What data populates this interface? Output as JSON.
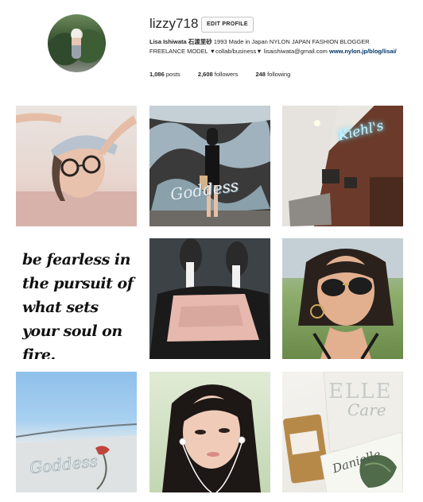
{
  "profile": {
    "username": "lizzy718",
    "edit_label": "EDIT PROFILE",
    "bio_name": "Lisa Ishiwata 石渡里砂",
    "bio_text": " 1993 Made in Japan NYLON JAPAN FASHION BLOGGER FREELANCE MODEL ▼collab/business▼ lisaishiwata@gmail.com ",
    "bio_link": "www.nylon.jp/blog/lisai/"
  },
  "stats": {
    "posts_count": "1,086",
    "posts_label": "posts",
    "followers_count": "2,608",
    "followers_label": "followers",
    "following_count": "248",
    "following_label": "following"
  },
  "posts": [
    {
      "id": "post-1"
    },
    {
      "id": "post-2",
      "overlay_text": "Goddess"
    },
    {
      "id": "post-3",
      "overlay_text": "Kiehl's"
    },
    {
      "id": "post-4",
      "overlay_text": "be fearless in the pursuit of what sets your soul on fire."
    },
    {
      "id": "post-5"
    },
    {
      "id": "post-6"
    },
    {
      "id": "post-7",
      "overlay_text": "Goddess"
    },
    {
      "id": "post-8"
    },
    {
      "id": "post-9",
      "overlay_text": "ELLE",
      "overlay_text_2": "Care",
      "overlay_text_3": "Danielle"
    }
  ],
  "colors": {
    "link": "#003569",
    "text": "#262626",
    "border": "#c7c7c7"
  }
}
